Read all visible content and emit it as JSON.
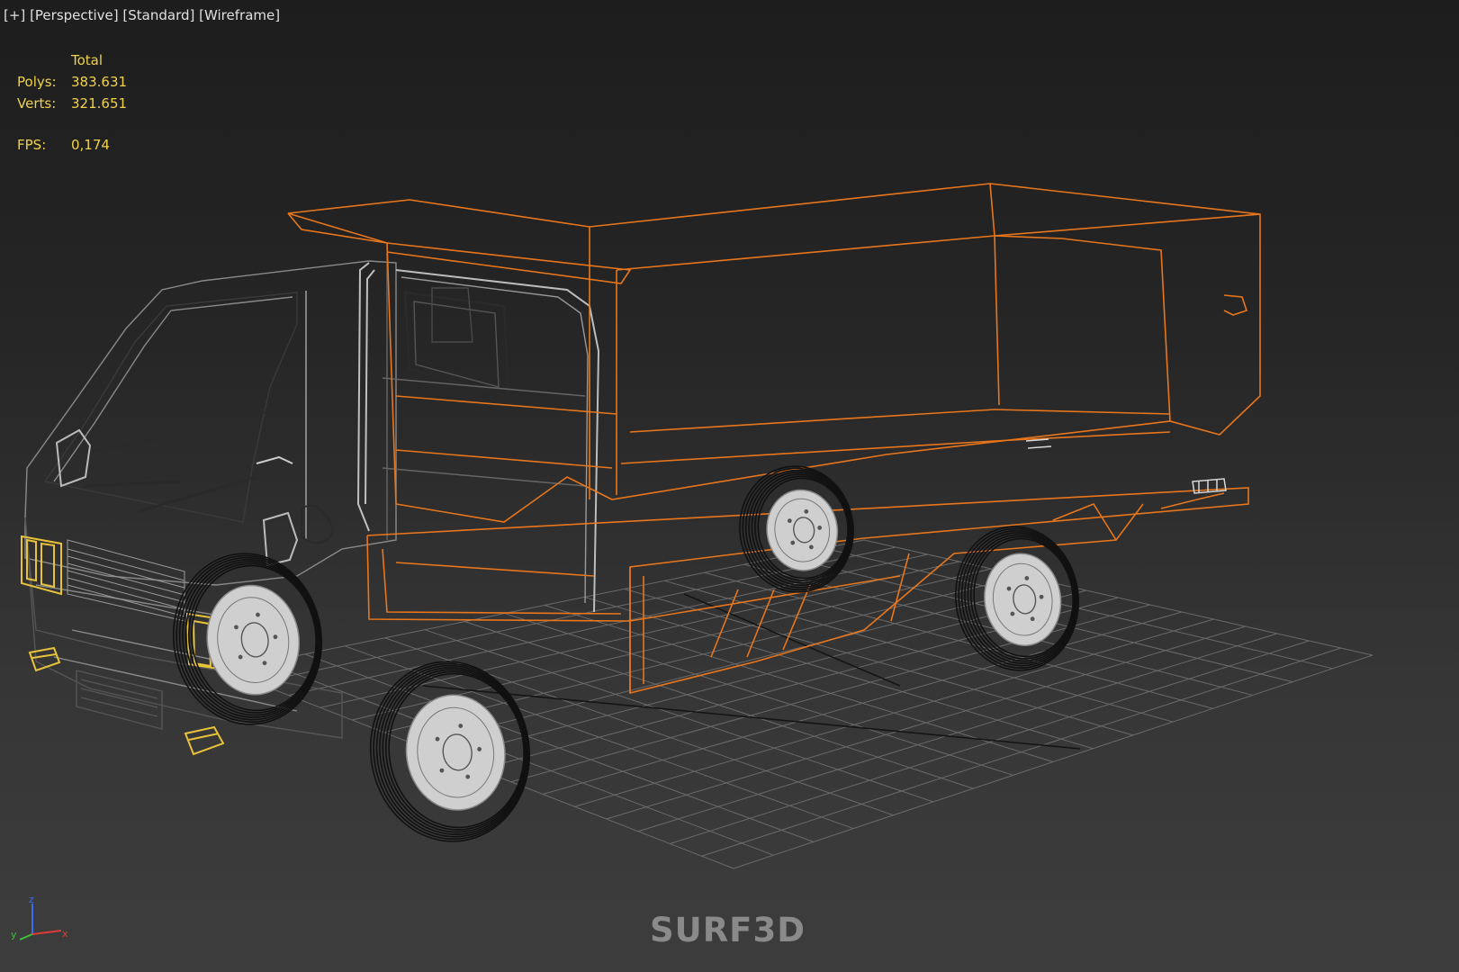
{
  "viewport": {
    "label_plus": "[+]",
    "label_view": "[Perspective]",
    "label_shading": "[Standard]",
    "label_mode": "[Wireframe]"
  },
  "stats": {
    "header": "Total",
    "polys_label": "Polys:",
    "polys_value": "383.631",
    "verts_label": "Verts:",
    "verts_value": "321.651",
    "fps_label": "FPS:",
    "fps_value": "0,174"
  },
  "gizmo": {
    "z": "z",
    "y": "y",
    "x": "x"
  },
  "watermark": "SURF3D",
  "colors": {
    "wire_orange": "#e8761c",
    "wire_gray": "#8a8a8a",
    "wire_dark": "#222222",
    "wire_yellow": "#e8c23a",
    "grid": "#6a6a6a",
    "stats_text": "#f0d24a"
  }
}
